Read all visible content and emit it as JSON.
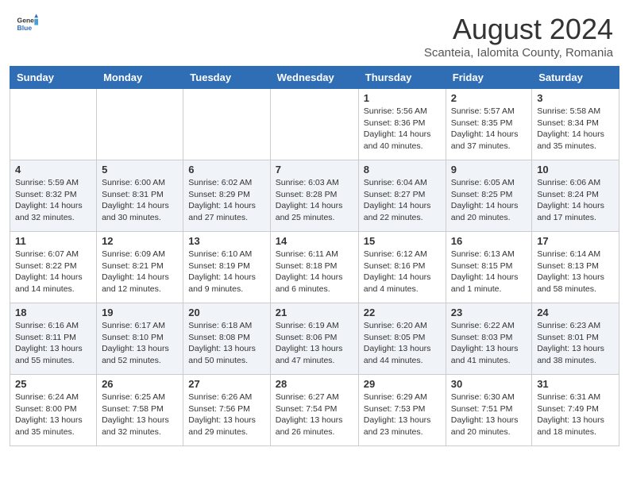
{
  "header": {
    "logo_general": "General",
    "logo_blue": "Blue",
    "title": "August 2024",
    "subtitle": "Scanteia, Ialomita County, Romania"
  },
  "weekdays": [
    "Sunday",
    "Monday",
    "Tuesday",
    "Wednesday",
    "Thursday",
    "Friday",
    "Saturday"
  ],
  "weeks": [
    [
      {
        "day": "",
        "info": ""
      },
      {
        "day": "",
        "info": ""
      },
      {
        "day": "",
        "info": ""
      },
      {
        "day": "",
        "info": ""
      },
      {
        "day": "1",
        "info": "Sunrise: 5:56 AM\nSunset: 8:36 PM\nDaylight: 14 hours\nand 40 minutes."
      },
      {
        "day": "2",
        "info": "Sunrise: 5:57 AM\nSunset: 8:35 PM\nDaylight: 14 hours\nand 37 minutes."
      },
      {
        "day": "3",
        "info": "Sunrise: 5:58 AM\nSunset: 8:34 PM\nDaylight: 14 hours\nand 35 minutes."
      }
    ],
    [
      {
        "day": "4",
        "info": "Sunrise: 5:59 AM\nSunset: 8:32 PM\nDaylight: 14 hours\nand 32 minutes."
      },
      {
        "day": "5",
        "info": "Sunrise: 6:00 AM\nSunset: 8:31 PM\nDaylight: 14 hours\nand 30 minutes."
      },
      {
        "day": "6",
        "info": "Sunrise: 6:02 AM\nSunset: 8:29 PM\nDaylight: 14 hours\nand 27 minutes."
      },
      {
        "day": "7",
        "info": "Sunrise: 6:03 AM\nSunset: 8:28 PM\nDaylight: 14 hours\nand 25 minutes."
      },
      {
        "day": "8",
        "info": "Sunrise: 6:04 AM\nSunset: 8:27 PM\nDaylight: 14 hours\nand 22 minutes."
      },
      {
        "day": "9",
        "info": "Sunrise: 6:05 AM\nSunset: 8:25 PM\nDaylight: 14 hours\nand 20 minutes."
      },
      {
        "day": "10",
        "info": "Sunrise: 6:06 AM\nSunset: 8:24 PM\nDaylight: 14 hours\nand 17 minutes."
      }
    ],
    [
      {
        "day": "11",
        "info": "Sunrise: 6:07 AM\nSunset: 8:22 PM\nDaylight: 14 hours\nand 14 minutes."
      },
      {
        "day": "12",
        "info": "Sunrise: 6:09 AM\nSunset: 8:21 PM\nDaylight: 14 hours\nand 12 minutes."
      },
      {
        "day": "13",
        "info": "Sunrise: 6:10 AM\nSunset: 8:19 PM\nDaylight: 14 hours\nand 9 minutes."
      },
      {
        "day": "14",
        "info": "Sunrise: 6:11 AM\nSunset: 8:18 PM\nDaylight: 14 hours\nand 6 minutes."
      },
      {
        "day": "15",
        "info": "Sunrise: 6:12 AM\nSunset: 8:16 PM\nDaylight: 14 hours\nand 4 minutes."
      },
      {
        "day": "16",
        "info": "Sunrise: 6:13 AM\nSunset: 8:15 PM\nDaylight: 14 hours\nand 1 minute."
      },
      {
        "day": "17",
        "info": "Sunrise: 6:14 AM\nSunset: 8:13 PM\nDaylight: 13 hours\nand 58 minutes."
      }
    ],
    [
      {
        "day": "18",
        "info": "Sunrise: 6:16 AM\nSunset: 8:11 PM\nDaylight: 13 hours\nand 55 minutes."
      },
      {
        "day": "19",
        "info": "Sunrise: 6:17 AM\nSunset: 8:10 PM\nDaylight: 13 hours\nand 52 minutes."
      },
      {
        "day": "20",
        "info": "Sunrise: 6:18 AM\nSunset: 8:08 PM\nDaylight: 13 hours\nand 50 minutes."
      },
      {
        "day": "21",
        "info": "Sunrise: 6:19 AM\nSunset: 8:06 PM\nDaylight: 13 hours\nand 47 minutes."
      },
      {
        "day": "22",
        "info": "Sunrise: 6:20 AM\nSunset: 8:05 PM\nDaylight: 13 hours\nand 44 minutes."
      },
      {
        "day": "23",
        "info": "Sunrise: 6:22 AM\nSunset: 8:03 PM\nDaylight: 13 hours\nand 41 minutes."
      },
      {
        "day": "24",
        "info": "Sunrise: 6:23 AM\nSunset: 8:01 PM\nDaylight: 13 hours\nand 38 minutes."
      }
    ],
    [
      {
        "day": "25",
        "info": "Sunrise: 6:24 AM\nSunset: 8:00 PM\nDaylight: 13 hours\nand 35 minutes."
      },
      {
        "day": "26",
        "info": "Sunrise: 6:25 AM\nSunset: 7:58 PM\nDaylight: 13 hours\nand 32 minutes."
      },
      {
        "day": "27",
        "info": "Sunrise: 6:26 AM\nSunset: 7:56 PM\nDaylight: 13 hours\nand 29 minutes."
      },
      {
        "day": "28",
        "info": "Sunrise: 6:27 AM\nSunset: 7:54 PM\nDaylight: 13 hours\nand 26 minutes."
      },
      {
        "day": "29",
        "info": "Sunrise: 6:29 AM\nSunset: 7:53 PM\nDaylight: 13 hours\nand 23 minutes."
      },
      {
        "day": "30",
        "info": "Sunrise: 6:30 AM\nSunset: 7:51 PM\nDaylight: 13 hours\nand 20 minutes."
      },
      {
        "day": "31",
        "info": "Sunrise: 6:31 AM\nSunset: 7:49 PM\nDaylight: 13 hours\nand 18 minutes."
      }
    ]
  ]
}
